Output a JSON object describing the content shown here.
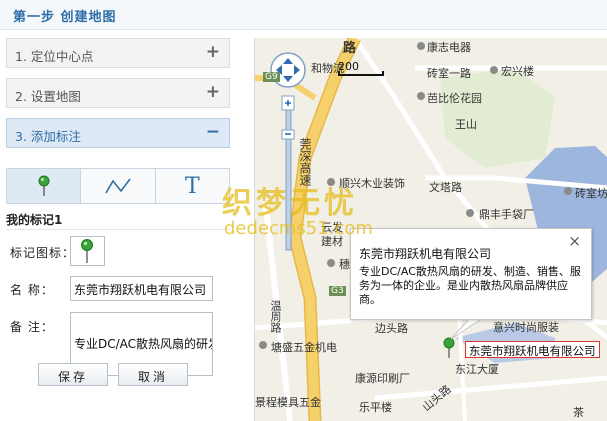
{
  "header": {
    "title": "第一步 创建地图"
  },
  "steps": [
    {
      "label": "1. 定位中心点",
      "sign": "+"
    },
    {
      "label": "2. 设置地图",
      "sign": "+"
    },
    {
      "label": "3. 添加标注",
      "sign": "−"
    }
  ],
  "tools": [
    {
      "name": "marker-tool",
      "icon": "pin-icon"
    },
    {
      "name": "line-tool",
      "icon": "polyline-icon"
    },
    {
      "name": "text-tool",
      "icon": "text-icon",
      "glyph": "T"
    }
  ],
  "markers_panel": {
    "title": "我的标记1",
    "icon_label": "标记图标：",
    "name_label": "名 称：",
    "name_value": "东莞市翔跃机电有限公司",
    "note_label": "备 注：",
    "note_value": "专业DC/AC散热风扇的研发、制造、销售、服务为一体的企业。是业内散热风扇品牌供应商。",
    "save_label": "保存",
    "cancel_label": "取消"
  },
  "map": {
    "scale_label": "200",
    "places": [
      "路",
      "康志电器",
      "和物流",
      "砖室一路",
      "宏兴楼",
      "芭比伦花园",
      "王山",
      "莞深高速",
      "顺兴木业装饰",
      "文塔路",
      "砖室坊",
      "云发",
      "建材",
      "鼎丰手袋厂",
      "穗丰石",
      "温周路",
      "G9",
      "边头路",
      "塘盛五金机电",
      "康源印刷厂",
      "东江大厦",
      "乐平楼",
      "山头路",
      "景程模具五金",
      "茶",
      "意兴时尚服装",
      "G3"
    ],
    "popup": {
      "title": "东莞市翔跃机电有限公司",
      "desc": "专业DC/AC散热风扇的研发、制造、销售、服务为一体的企业。是业内散热风扇品牌供应商。",
      "close": "×"
    },
    "marker_label": "东莞市翔跃机电有限公司"
  },
  "watermark": {
    "cn": "织梦无忧",
    "en": "dedecms51.com"
  },
  "colors": {
    "accent": "#2f6ea8",
    "road_main": "#f5d06b",
    "water": "#9db6de",
    "marker": "#3aa33a"
  }
}
